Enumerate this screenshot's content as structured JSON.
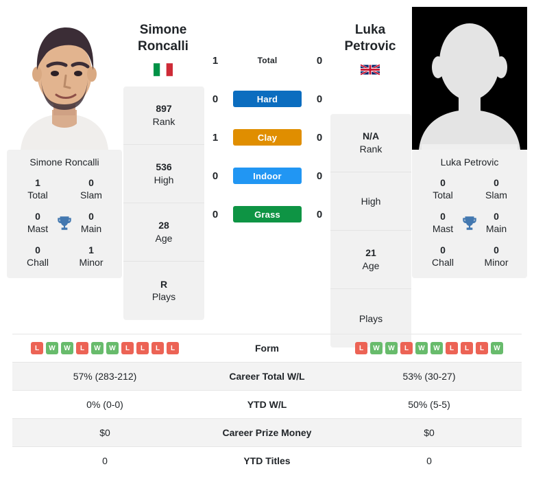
{
  "players": {
    "left": {
      "first_name": "Simone",
      "last_name": "Roncalli",
      "full_name": "Simone Roncalli",
      "country": "Italy",
      "flag_icon": "flag-italy-icon",
      "photo_type": "headshot-photo",
      "stats": [
        {
          "value": "897",
          "label": "Rank"
        },
        {
          "value": "536",
          "label": "High"
        },
        {
          "value": "28",
          "label": "Age"
        },
        {
          "value": "R",
          "label": "Plays"
        }
      ],
      "titles": [
        {
          "value": "1",
          "label": "Total"
        },
        {
          "value": "0",
          "label": "Slam"
        },
        {
          "value": "0",
          "label": "Mast"
        },
        {
          "value": "0",
          "label": "Main"
        },
        {
          "value": "0",
          "label": "Chall"
        },
        {
          "value": "1",
          "label": "Minor"
        }
      ],
      "form": [
        "L",
        "W",
        "W",
        "L",
        "W",
        "W",
        "L",
        "L",
        "L",
        "L"
      ],
      "career_total_wl": "57% (283-212)",
      "ytd_wl": "0% (0-0)",
      "career_prize_money": "$0",
      "ytd_titles": "0"
    },
    "right": {
      "first_name": "Luka",
      "last_name": "Petrovic",
      "full_name": "Luka Petrovic",
      "country": "United Kingdom",
      "flag_icon": "flag-uk-icon",
      "photo_type": "silhouette-placeholder",
      "stats": [
        {
          "value": "N/A",
          "label": "Rank"
        },
        {
          "value": "",
          "label": "High"
        },
        {
          "value": "21",
          "label": "Age"
        },
        {
          "value": "",
          "label": "Plays"
        }
      ],
      "titles": [
        {
          "value": "0",
          "label": "Total"
        },
        {
          "value": "0",
          "label": "Slam"
        },
        {
          "value": "0",
          "label": "Mast"
        },
        {
          "value": "0",
          "label": "Main"
        },
        {
          "value": "0",
          "label": "Chall"
        },
        {
          "value": "0",
          "label": "Minor"
        }
      ],
      "form": [
        "L",
        "W",
        "W",
        "L",
        "W",
        "W",
        "L",
        "L",
        "L",
        "W"
      ],
      "career_total_wl": "53% (30-27)",
      "ytd_wl": "50% (5-5)",
      "career_prize_money": "$0",
      "ytd_titles": "0"
    }
  },
  "surfaces": [
    {
      "label": "Total",
      "left": "1",
      "right": "0",
      "color": "",
      "plain": true
    },
    {
      "label": "Hard",
      "left": "0",
      "right": "0",
      "color": "#0b6dbf",
      "plain": false
    },
    {
      "label": "Clay",
      "left": "1",
      "right": "0",
      "color": "#e08e00",
      "plain": false
    },
    {
      "label": "Indoor",
      "left": "0",
      "right": "0",
      "color": "#2196f3",
      "plain": false
    },
    {
      "label": "Grass",
      "left": "0",
      "right": "0",
      "color": "#0e9444",
      "plain": false
    }
  ],
  "table": {
    "rows": [
      {
        "label": "Form",
        "type": "form"
      },
      {
        "label": "Career Total W/L",
        "type": "text",
        "left": "57% (283-212)",
        "right": "53% (30-27)"
      },
      {
        "label": "YTD W/L",
        "type": "text",
        "left": "0% (0-0)",
        "right": "50% (5-5)"
      },
      {
        "label": "Career Prize Money",
        "type": "text",
        "left": "$0",
        "right": "$0"
      },
      {
        "label": "YTD Titles",
        "type": "text",
        "left": "0",
        "right": "0"
      }
    ]
  },
  "colors": {
    "win": "#68bb6c",
    "loss": "#ec6355",
    "hard": "#0b6dbf",
    "clay": "#e08e00",
    "indoor": "#2196f3",
    "grass": "#0e9444",
    "trophy": "#4378b0",
    "card_bg": "#f1f1f1"
  }
}
